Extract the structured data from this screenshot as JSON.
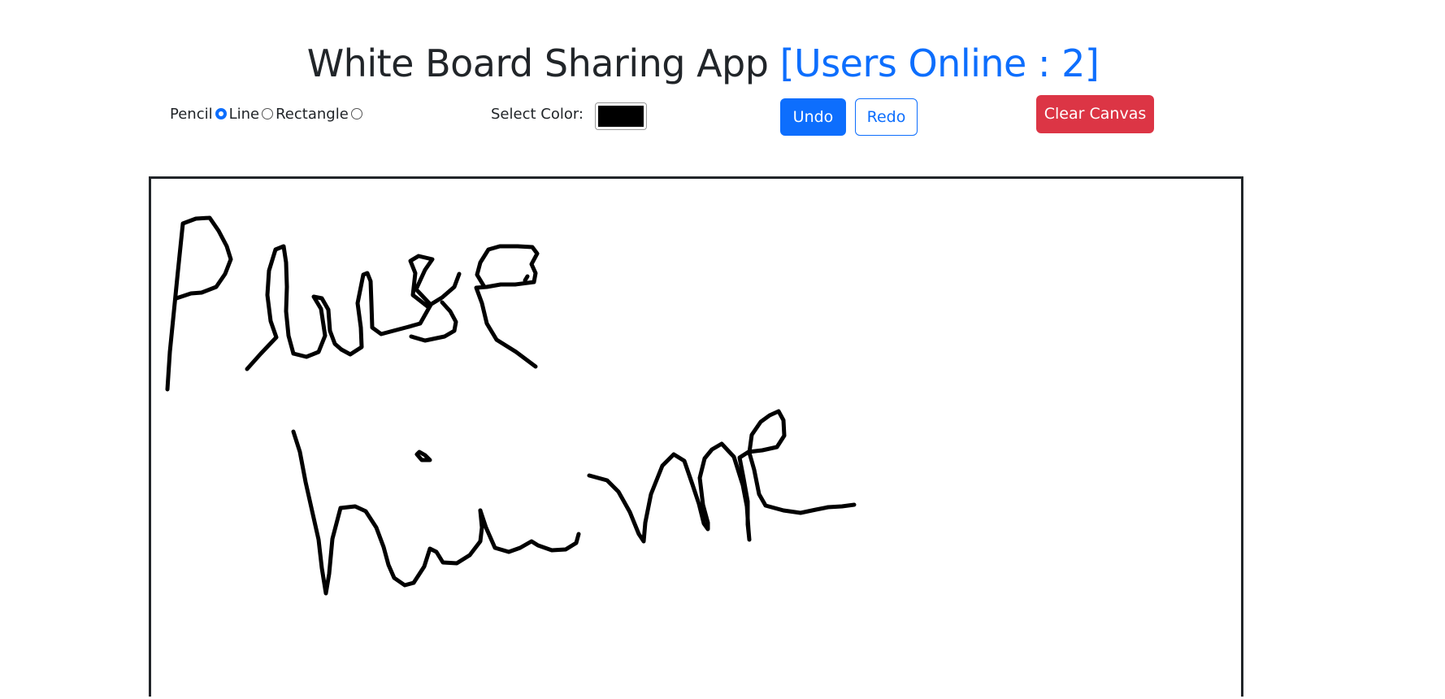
{
  "header": {
    "title": "White Board Sharing App",
    "users_online": "[Users Online : 2]"
  },
  "tools": {
    "options": [
      {
        "label": "Pencil",
        "selected": true
      },
      {
        "label": "Line",
        "selected": false
      },
      {
        "label": "Rectangle",
        "selected": false
      }
    ]
  },
  "color_picker": {
    "label": "Select Color:",
    "value": "#000000"
  },
  "buttons": {
    "undo": "Undo",
    "redo": "Redo",
    "clear": "Clear Canvas"
  },
  "colors": {
    "accent": "#0d6efd",
    "danger": "#dc3545",
    "stroke": "#000000"
  },
  "canvas": {
    "drawing_description_text": "Please hire me"
  }
}
